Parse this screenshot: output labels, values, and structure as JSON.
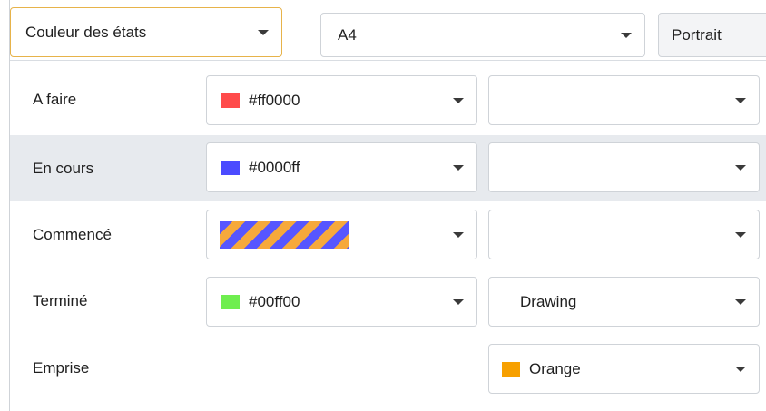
{
  "toolbar": {
    "mode_select": "Couleur des états",
    "paper_size": "A4",
    "orientation_button": "Portrait"
  },
  "colors": {
    "accent_border": "#e7b34a",
    "selected_row_bg": "#e7eaee",
    "stripe_a": "#5656ff",
    "stripe_b": "#f6a93b"
  },
  "rows": [
    {
      "label": "A faire",
      "color_value": "#ff0000",
      "swatch": "#ff4b4b",
      "secondary_value": ""
    },
    {
      "label": "En cours",
      "color_value": "#0000ff",
      "swatch": "#4b4bff",
      "secondary_value": ""
    },
    {
      "label": "Commencé",
      "color_value": "",
      "swatch": "striped",
      "secondary_value": ""
    },
    {
      "label": "Terminé",
      "color_value": "#00ff00",
      "swatch": "#6fee4f",
      "secondary_value": "Drawing"
    },
    {
      "label": "Emprise",
      "secondary_value": "Orange",
      "secondary_swatch": "#f7a000"
    }
  ]
}
